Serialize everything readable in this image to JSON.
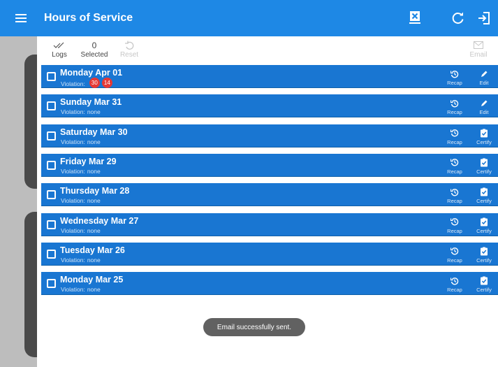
{
  "appbar": {
    "title": "Hours of Service",
    "icons": [
      "menu-icon",
      "pdf-export-icon",
      "refresh-icon",
      "logout-icon"
    ]
  },
  "toolbar": {
    "logs_label": "Logs",
    "selected_count": "0",
    "selected_label": "Selected",
    "reset_label": "Reset",
    "email_label": "Email"
  },
  "logs": [
    {
      "date": "Monday Apr 01",
      "violation_label": "Violation:",
      "violation": "",
      "badges": [
        "30",
        "14"
      ],
      "recap_label": "Recap",
      "action_label": "Edit",
      "action_icon": "pencil-icon"
    },
    {
      "date": "Sunday Mar 31",
      "violation_label": "Violation:",
      "violation": "none",
      "badges": [],
      "recap_label": "Recap",
      "action_label": "Edit",
      "action_icon": "pencil-icon"
    },
    {
      "date": "Saturday Mar 30",
      "violation_label": "Violation:",
      "violation": "none",
      "badges": [],
      "recap_label": "Recap",
      "action_label": "Certify",
      "action_icon": "clipboard-check-icon"
    },
    {
      "date": "Friday Mar 29",
      "violation_label": "Violation:",
      "violation": "none",
      "badges": [],
      "recap_label": "Recap",
      "action_label": "Certify",
      "action_icon": "clipboard-check-icon"
    },
    {
      "date": "Thursday Mar 28",
      "violation_label": "Violation:",
      "violation": "none",
      "badges": [],
      "recap_label": "Recap",
      "action_label": "Certify",
      "action_icon": "clipboard-check-icon"
    },
    {
      "date": "Wednesday Mar 27",
      "violation_label": "Violation:",
      "violation": "none",
      "badges": [],
      "recap_label": "Recap",
      "action_label": "Certify",
      "action_icon": "clipboard-check-icon"
    },
    {
      "date": "Tuesday Mar 26",
      "violation_label": "Violation:",
      "violation": "none",
      "badges": [],
      "recap_label": "Recap",
      "action_label": "Certify",
      "action_icon": "clipboard-check-icon"
    },
    {
      "date": "Monday Mar 25",
      "violation_label": "Violation:",
      "violation": "none",
      "badges": [],
      "recap_label": "Recap",
      "action_label": "Certify",
      "action_icon": "clipboard-check-icon"
    }
  ],
  "toast": "Email successfully sent.",
  "colors": {
    "appbar": "#1e88e5",
    "row": "#1976d2",
    "badge": "#e53935",
    "toast": "#616161"
  }
}
